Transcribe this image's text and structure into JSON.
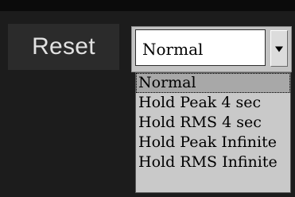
{
  "reset_button": {
    "label": "Reset"
  },
  "meter_mode_dropdown": {
    "selected_value": "Normal",
    "options": [
      "Normal",
      "Hold Peak 4 sec",
      "Hold RMS 4 sec",
      "Hold Peak Infinite",
      "Hold RMS Infinite"
    ],
    "highlighted_index": 0
  },
  "icons": {
    "dropdown_arrow": "chevron-down-icon"
  },
  "colors": {
    "background": "#1c1c1c",
    "button_bg": "#2b2b2b",
    "button_text": "#e2e2e2",
    "dropdown_bg": "#c3c3c3",
    "list_bg": "#c9c9c9",
    "highlight_bg": "#a8a8a8"
  }
}
